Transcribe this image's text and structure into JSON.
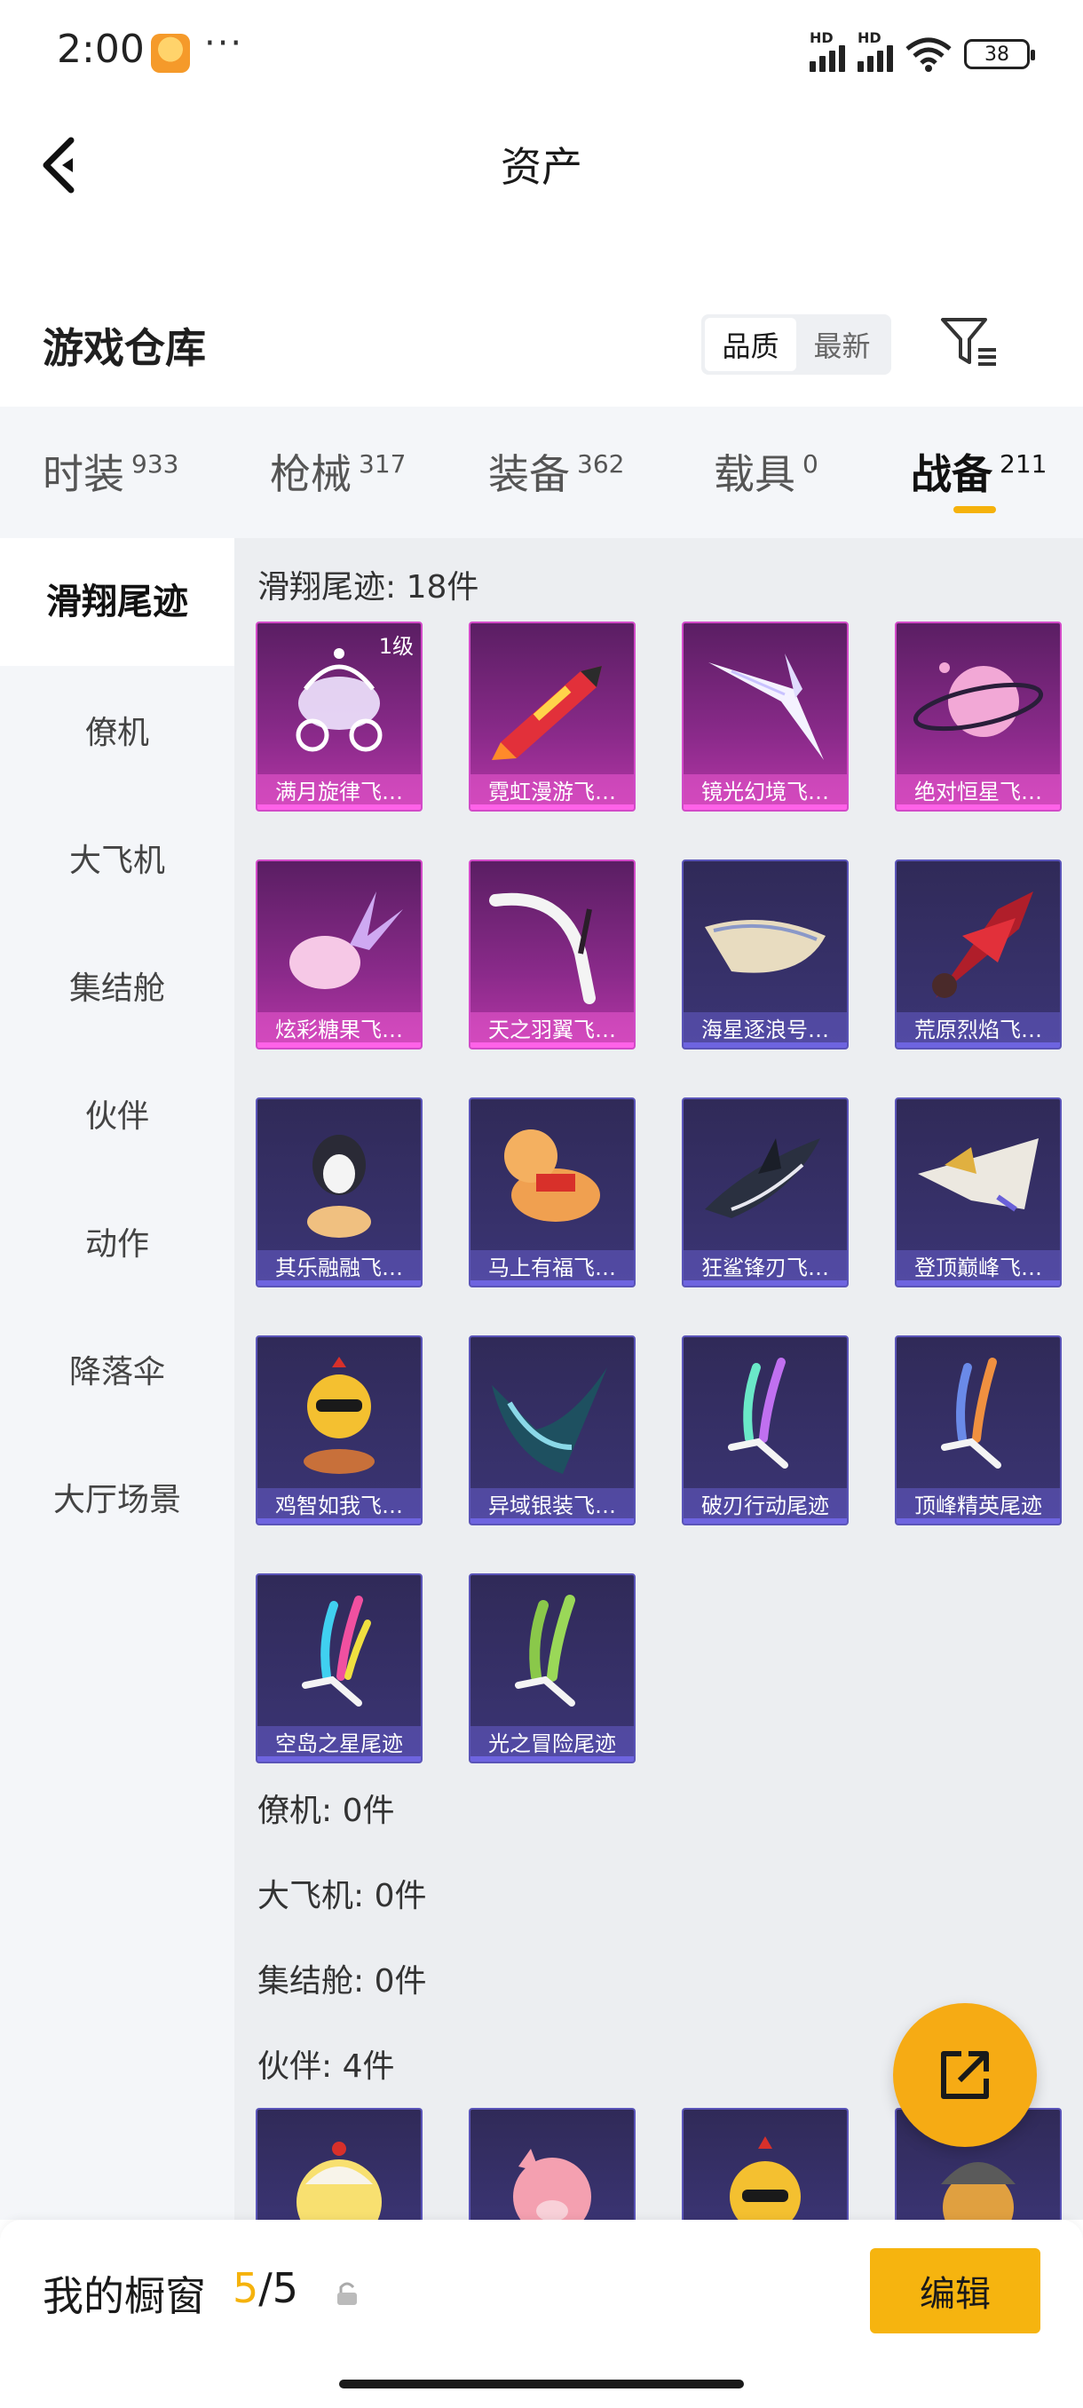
{
  "status_bar": {
    "time": "2:00",
    "dots": "···",
    "battery": "38",
    "hd1": "HD",
    "hd2": "HD"
  },
  "nav": {
    "title": "资产"
  },
  "warehouse": {
    "title": "游戏仓库",
    "sort_options": [
      "品质",
      "最新"
    ],
    "sort_active": "品质"
  },
  "tabs": [
    {
      "label": "时装",
      "count": "933"
    },
    {
      "label": "枪械",
      "count": "317"
    },
    {
      "label": "装备",
      "count": "362"
    },
    {
      "label": "载具",
      "count": "0"
    },
    {
      "label": "战备",
      "count": "211",
      "active": true
    }
  ],
  "sidebar": {
    "items": [
      "滑翔尾迹",
      "僚机",
      "大飞机",
      "集结舱",
      "伙伴",
      "动作",
      "降落伞",
      "大厅场景"
    ],
    "active": "滑翔尾迹"
  },
  "sections": {
    "glide": {
      "label": "滑翔尾迹: 18件",
      "items": [
        {
          "name": "满月旋律飞…",
          "rarity": "pink",
          "level": "1级",
          "icon": "carriage-icon"
        },
        {
          "name": "霓虹漫游飞…",
          "rarity": "pink",
          "icon": "rocket-icon"
        },
        {
          "name": "镜光幻境飞…",
          "rarity": "pink",
          "icon": "crystal-wing-icon"
        },
        {
          "name": "绝对恒星飞…",
          "rarity": "pink",
          "icon": "planet-icon"
        },
        {
          "name": "炫彩糖果飞…",
          "rarity": "pink",
          "icon": "candy-icon"
        },
        {
          "name": "天之羽翼飞…",
          "rarity": "pink",
          "icon": "feather-wing-icon"
        },
        {
          "name": "海星逐浪号…",
          "rarity": "purple",
          "icon": "boat-icon"
        },
        {
          "name": "荒原烈焰飞…",
          "rarity": "purple",
          "icon": "fire-glider-icon"
        },
        {
          "name": "其乐融融飞…",
          "rarity": "purple",
          "icon": "penguin-icon"
        },
        {
          "name": "马上有福飞…",
          "rarity": "purple",
          "icon": "horse-icon"
        },
        {
          "name": "狂鲨锋刃飞…",
          "rarity": "purple",
          "icon": "shark-icon"
        },
        {
          "name": "登顶巅峰飞…",
          "rarity": "purple",
          "icon": "jet-icon"
        },
        {
          "name": "鸡智如我飞…",
          "rarity": "purple",
          "icon": "chicken-icon"
        },
        {
          "name": "异域银装飞…",
          "rarity": "purple",
          "icon": "blade-wing-icon"
        },
        {
          "name": "破刃行动尾迹",
          "rarity": "purple",
          "icon": "smoke-trail-icon"
        },
        {
          "name": "顶峰精英尾迹",
          "rarity": "purple",
          "icon": "smoke-trail-icon"
        },
        {
          "name": "空岛之星尾迹",
          "rarity": "purple",
          "icon": "rainbow-trail-icon"
        },
        {
          "name": "光之冒险尾迹",
          "rarity": "purple",
          "icon": "green-trail-icon"
        }
      ]
    },
    "wingman": {
      "label": "僚机: 0件"
    },
    "airplane": {
      "label": "大飞机: 0件"
    },
    "pod": {
      "label": "集结舱: 0件"
    },
    "partner": {
      "label": "伙伴: 4件",
      "icons": [
        "egg-chick-icon",
        "pink-pig-icon",
        "chicken-icon",
        "helmet-bird-icon"
      ]
    }
  },
  "fab": {
    "icon": "share-external-icon"
  },
  "bottom": {
    "label": "我的橱窗",
    "current": "5",
    "separator": "/",
    "total": "5",
    "edit": "编辑"
  },
  "colors": {
    "accent": "#f5b20c",
    "pink_card": "#d24ac8",
    "purple_card": "#5a54b8"
  }
}
